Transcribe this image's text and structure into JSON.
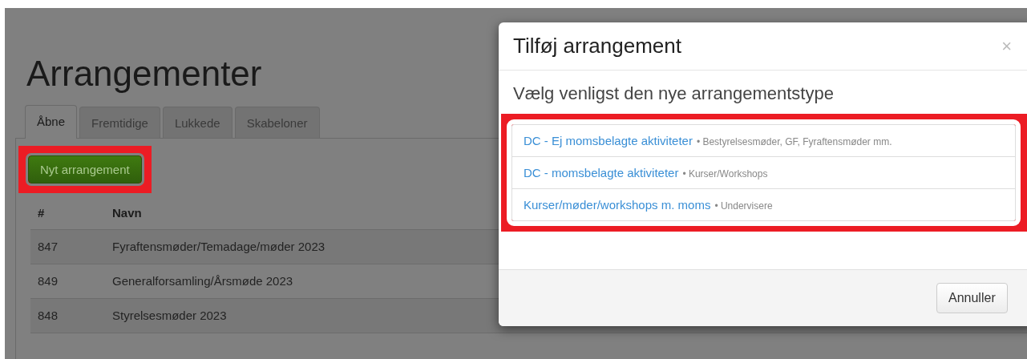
{
  "page": {
    "title": "Arrangementer",
    "tabs": [
      {
        "label": "Åbne",
        "selected": true
      },
      {
        "label": "Fremtidige",
        "selected": false
      },
      {
        "label": "Lukkede",
        "selected": false
      },
      {
        "label": "Skabeloner",
        "selected": false
      }
    ],
    "new_button": {
      "label": "Nyt arrangement",
      "highlighted": true
    },
    "table": {
      "columns": [
        "#",
        "Navn"
      ],
      "rows": [
        [
          "847",
          "Fyraftensmøder/Temadage/møder 2023"
        ],
        [
          "849",
          "Generalforsamling/Årsmøde 2023"
        ],
        [
          "848",
          "Styrelsesmøder 2023"
        ]
      ]
    }
  },
  "modal": {
    "title": "Tilføj arrangement",
    "close": "×",
    "subtitle": "Vælg venligst den nye arrangementstype",
    "options_highlighted": true,
    "options": [
      {
        "name": "DC - Ej momsbelagte aktiviteter",
        "description": "• Bestyrelsesmøder, GF, Fyraftensmøder mm."
      },
      {
        "name": "DC - momsbelagte aktiviteter",
        "description": "• Kurser/Workshops"
      },
      {
        "name": "Kurser/møder/workshops m. moms",
        "description": "• Undervisere"
      }
    ],
    "cancel": "Annuller"
  }
}
